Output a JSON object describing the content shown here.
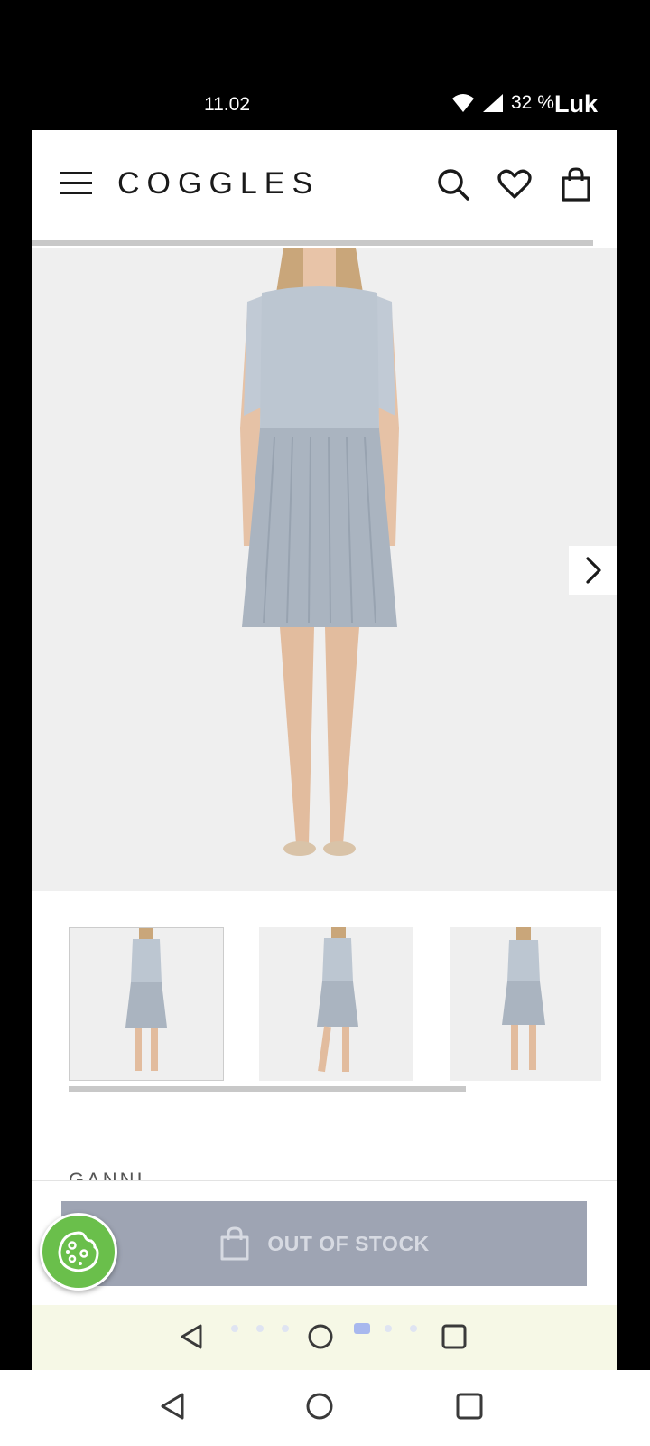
{
  "status_bar": {
    "time": "11.02",
    "battery": "32 %",
    "overlay_text": "Luk"
  },
  "header": {
    "brand": "COGGLES"
  },
  "product": {
    "brand_partial": "GANNI"
  },
  "actions": {
    "out_of_stock_label": "OUT OF STOCK"
  },
  "colors": {
    "hero_bg": "#efefef",
    "oos_button": "#9ea4b3",
    "cookie_green": "#6abf4b",
    "dress_lace": "#b9c3cf"
  },
  "icons": [
    "menu-icon",
    "search-icon",
    "heart-icon",
    "shopping-bag-icon",
    "chevron-right-icon",
    "zoom-in-icon",
    "cookie-icon",
    "back-icon",
    "home-icon",
    "recents-icon"
  ]
}
